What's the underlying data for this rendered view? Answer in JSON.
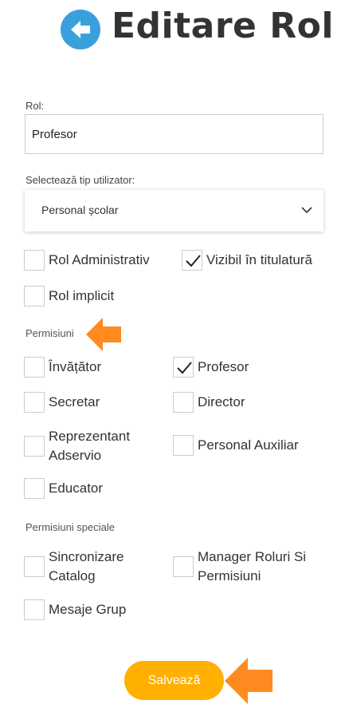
{
  "header": {
    "title": "Editare Rol",
    "back_icon": "arrow-left-icon",
    "back_color": "#3aa0dc"
  },
  "form": {
    "rol_label": "Rol:",
    "rol_value": "Profesor",
    "tip_label": "Selectează tip utilizator:",
    "tip_value": "Personal școlar"
  },
  "options": [
    {
      "label": "Rol Administrativ",
      "checked": false
    },
    {
      "label": "Vizibil în titulatură",
      "checked": true
    },
    {
      "label": "Rol implicit",
      "checked": false
    }
  ],
  "permisiuni": {
    "title": "Permisiuni",
    "items": [
      {
        "label": "Învățător",
        "checked": false
      },
      {
        "label": "Profesor",
        "checked": true
      },
      {
        "label": "Secretar",
        "checked": false
      },
      {
        "label": "Director",
        "checked": false
      },
      {
        "label": "Reprezentant Adservio",
        "checked": false
      },
      {
        "label": "Personal Auxiliar",
        "checked": false
      },
      {
        "label": "Educator",
        "checked": false
      }
    ]
  },
  "permisiuni_speciale": {
    "title": "Permisiuni speciale",
    "items": [
      {
        "label": "Sincronizare Catalog",
        "checked": false
      },
      {
        "label": "Manager Roluri Si Permisiuni",
        "checked": false
      },
      {
        "label": "Mesaje Grup",
        "checked": false
      }
    ]
  },
  "save_label": "Salvează",
  "colors": {
    "accent": "#ffb000",
    "pointer_arrow": "#ff8a20",
    "checkbox_border": "#cccccc"
  }
}
